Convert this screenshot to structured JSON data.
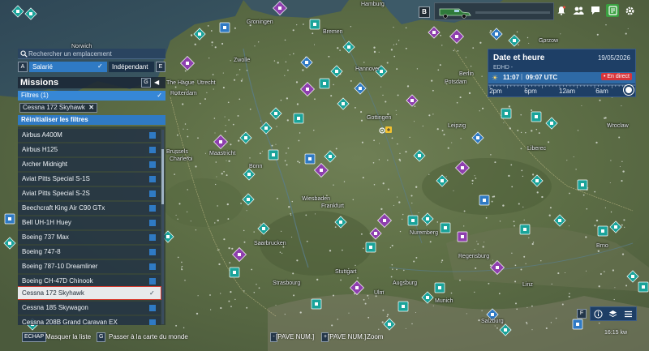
{
  "search": {
    "placeholder": "Rechercher un emplacement"
  },
  "mode": {
    "left_key": "A",
    "salarie_label": "Salarié",
    "independant_label": "Indépendant",
    "right_key": "E"
  },
  "missions": {
    "title": "Missions",
    "key": "G",
    "filters_label": "Filtres (1)",
    "active_chip": "Cessna 172 Skyhawk",
    "reset_label": "Réinitialiser les filtres",
    "aircraft": [
      "Airbus A400M",
      "Airbus H125",
      "Archer Midnight",
      "Aviat Pitts Special S-1S",
      "Aviat Pitts Special S-2S",
      "Beechcraft King Air C90 GTx",
      "Bell UH-1H Huey",
      "Boeing 737 Max",
      "Boeing 747-8",
      "Boeing 787-10 Dreamliner",
      "Boeing CH-47D Chinook",
      "Cessna 172 Skyhawk",
      "Cessna 185 Skywagon",
      "Cessna 208B Grand Caravan EX"
    ],
    "selected_aircraft": "Cessna 172 Skyhawk"
  },
  "hud": {
    "b_key": "B"
  },
  "date_panel": {
    "title": "Date et heure",
    "date": "19/05/2026",
    "airport": "EDHD -",
    "local_time": "11:07",
    "separator": "|",
    "utc_time": "09:07 UTC",
    "live_label": "• En direct",
    "ticks": [
      "2pm",
      "6pm",
      "12am",
      "6am"
    ]
  },
  "bottom_bar": {
    "echap_key": "ECHAP",
    "hide_list": "Masquer la liste",
    "g_key": "G",
    "world_map": "Passer à la carte du monde",
    "minus_key": "-",
    "minus_label": "[PAVE NUM.]",
    "plus_key": "+",
    "plus_label": "[PAVE NUM.]",
    "zoom": "Zoom"
  },
  "bottom_right": {
    "f_key": "F",
    "clock": "16:15 kw"
  },
  "cities": [
    "Norwich",
    "Hamburg",
    "Groningen",
    "Bremen",
    "Gorzow",
    "Zwolle",
    "Hannover",
    "The Hague",
    "Utrecht",
    "Rotterdam",
    "Berlin",
    "Potsdam",
    "Gottingen",
    "Leipzig",
    "Wroclaw",
    "Brussels",
    "Charleroi",
    "Maastricht",
    "Bonn",
    "Liberec",
    "Wiesbaden",
    "Frankfurt",
    "Saarbrucken",
    "Nuremberg",
    "Stuttgart",
    "Strasbourg",
    "Augsburg",
    "Munich",
    "Regensburg",
    "Salzburg",
    "Linz",
    "Brno",
    "Ulm"
  ],
  "colors": {
    "accent_blue": "#2f7ac4",
    "panel_navy": "#1e3f66",
    "live_red": "#d9343a",
    "selection_outline": "#d93a2e",
    "marker_teal": "#1aa39a",
    "marker_purple": "#8e3fae"
  }
}
